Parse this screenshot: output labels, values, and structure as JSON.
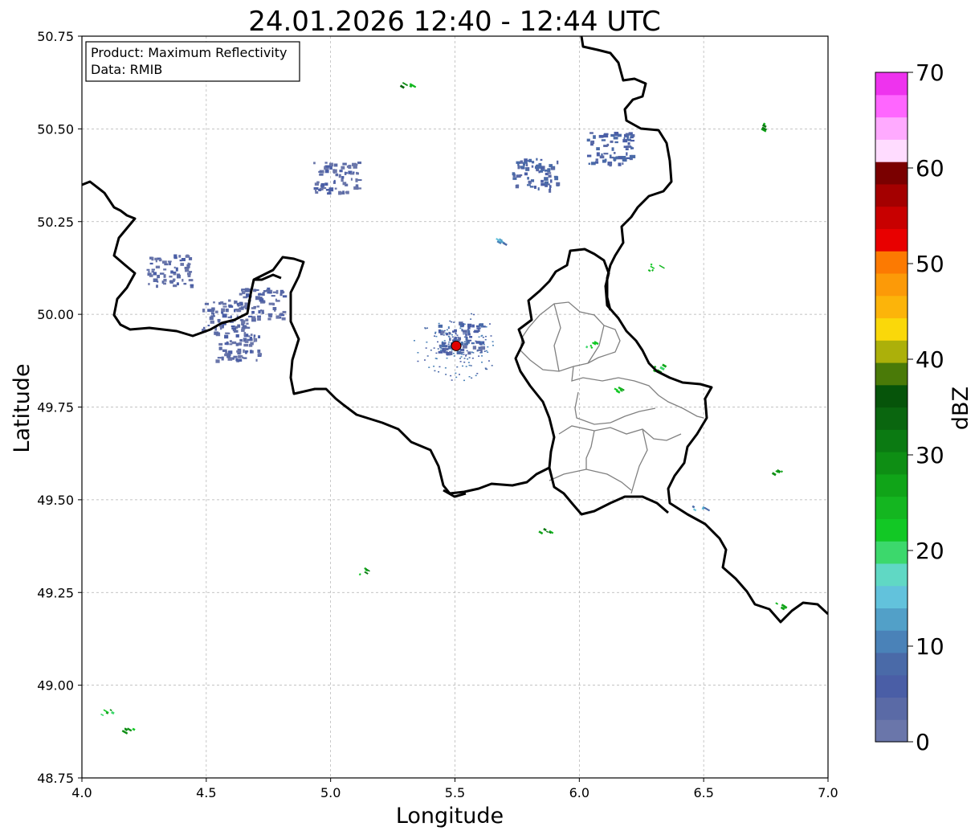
{
  "title": "24.01.2026 12:40 - 12:44 UTC",
  "info_box": {
    "product": "Product: Maximum Reflectivity",
    "data": "Data: RMIB"
  },
  "axes": {
    "xlabel": "Longitude",
    "ylabel": "Latitude",
    "xlim": [
      4.0,
      7.0
    ],
    "ylim": [
      48.75,
      50.75
    ],
    "xticks": [
      "4.0",
      "4.5",
      "5.0",
      "5.5",
      "6.0",
      "6.5",
      "7.0"
    ],
    "yticks": [
      "48.75",
      "49.00",
      "49.25",
      "49.50",
      "49.75",
      "50.00",
      "50.25",
      "50.50",
      "50.75"
    ],
    "grid": true
  },
  "radar_site": {
    "lon": 5.505,
    "lat": 49.915,
    "color": "#e00000"
  },
  "colorbar": {
    "label": "dBZ",
    "ticks": [
      "0",
      "10",
      "20",
      "30",
      "40",
      "50",
      "60",
      "70"
    ],
    "range": [
      0,
      70
    ],
    "colors": [
      "#6a76aa",
      "#5a6aa6",
      "#4a5ea6",
      "#4a6aa8",
      "#4a82b8",
      "#52a0c8",
      "#62c2dc",
      "#60d8c4",
      "#3cd86c",
      "#12c825",
      "#14b620",
      "#10a418",
      "#0e8e14",
      "#0b7a12",
      "#0a660f",
      "#06540a",
      "#4a7a08",
      "#acb00a",
      "#fad80a",
      "#fcb40a",
      "#fc9a08",
      "#fc7a02",
      "#e80000",
      "#c80000",
      "#a40000",
      "#7a0000",
      "#ffdcff",
      "#ffaaff",
      "#ff66ff",
      "#ee33ee"
    ]
  },
  "border_color": "#000000",
  "region_color": "#808080",
  "chart_data": {
    "type": "heatmap",
    "title": "24.01.2026 12:40 - 12:44 UTC",
    "xlabel": "Longitude",
    "ylabel": "Latitude",
    "xlim": [
      4.0,
      7.0
    ],
    "ylim": [
      48.75,
      50.75
    ],
    "color_range_dbz": [
      0,
      70
    ],
    "echoes": [
      {
        "lon": 4.62,
        "lat": 49.92,
        "dbz": 3
      },
      {
        "lon": 4.57,
        "lat": 50.0,
        "dbz": 3
      },
      {
        "lon": 4.35,
        "lat": 50.12,
        "dbz": 3
      },
      {
        "lon": 4.72,
        "lat": 50.03,
        "dbz": 3
      },
      {
        "lon": 5.02,
        "lat": 50.37,
        "dbz": 3
      },
      {
        "lon": 5.82,
        "lat": 50.38,
        "dbz": 6
      },
      {
        "lon": 6.12,
        "lat": 50.45,
        "dbz": 6
      },
      {
        "lon": 5.52,
        "lat": 49.94,
        "dbz": 5
      },
      {
        "lon": 5.68,
        "lat": 50.2,
        "dbz": 12
      },
      {
        "lon": 6.3,
        "lat": 50.13,
        "dbz": 25
      },
      {
        "lon": 6.05,
        "lat": 49.92,
        "dbz": 22
      },
      {
        "lon": 6.32,
        "lat": 49.86,
        "dbz": 22
      },
      {
        "lon": 6.15,
        "lat": 49.8,
        "dbz": 25
      },
      {
        "lon": 6.48,
        "lat": 49.48,
        "dbz": 12
      },
      {
        "lon": 6.79,
        "lat": 49.58,
        "dbz": 28
      },
      {
        "lon": 6.8,
        "lat": 49.22,
        "dbz": 28
      },
      {
        "lon": 5.86,
        "lat": 49.42,
        "dbz": 28
      },
      {
        "lon": 5.12,
        "lat": 49.31,
        "dbz": 28
      },
      {
        "lon": 4.1,
        "lat": 48.93,
        "dbz": 25
      },
      {
        "lon": 4.18,
        "lat": 48.88,
        "dbz": 25
      },
      {
        "lon": 6.75,
        "lat": 50.51,
        "dbz": 28
      },
      {
        "lon": 5.3,
        "lat": 50.62,
        "dbz": 28
      }
    ]
  }
}
